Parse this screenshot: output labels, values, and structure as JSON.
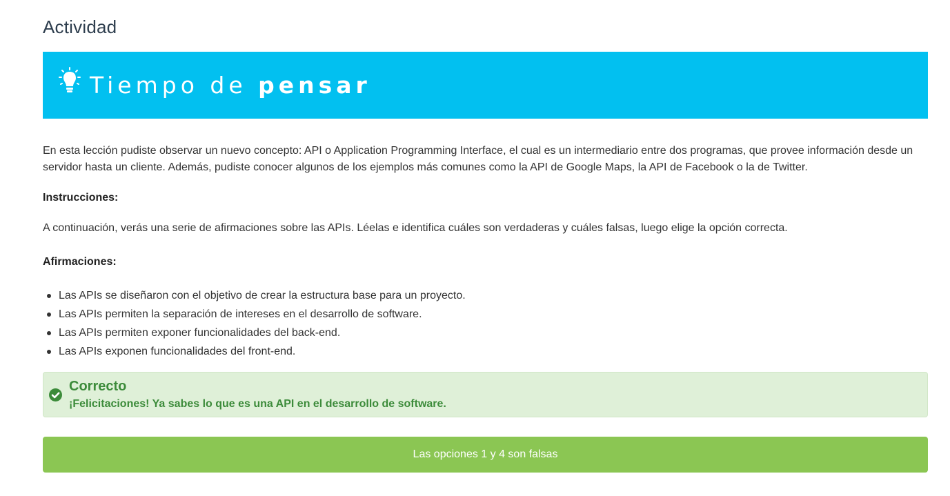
{
  "page": {
    "title": "Actividad"
  },
  "banner": {
    "text_regular": "Tiempo de ",
    "text_bold": "pensar",
    "background_color": "#02c0f0",
    "icon": "lightbulb-icon"
  },
  "content": {
    "intro": "En esta lección pudiste observar un nuevo concepto: API o Application Programming Interface, el cual es un intermediario entre dos programas, que provee información desde un servidor hasta un cliente. Además, pudiste conocer algunos de los ejemplos más comunes como la API de Google Maps, la API de Facebook o la de Twitter.",
    "instructions_heading": "Instrucciones:",
    "instructions_text": "A continuación, verás una serie de afirmaciones sobre las APIs. Léelas e identifica cuáles son verdaderas y cuáles falsas, luego elige la opción correcta.",
    "statements_heading": "Afirmaciones:",
    "statements": [
      "Las APIs se diseñaron con el objetivo de crear la estructura base para un proyecto.",
      "Las APIs permiten la separación de intereses en el desarrollo de software.",
      "Las APIs permiten exponer funcionalidades del back-end.",
      "Las APIs exponen funcionalidades del front-end."
    ]
  },
  "feedback": {
    "title": "Correcto",
    "message": "¡Felicitaciones! Ya sabes lo que es una API en el desarrollo de software.",
    "icon": "check-circle-icon",
    "color": "#3c8b3a",
    "background_color": "#dff0d8"
  },
  "answer": {
    "label": "Las opciones 1 y 4 son falsas",
    "color": "#8bc653"
  }
}
